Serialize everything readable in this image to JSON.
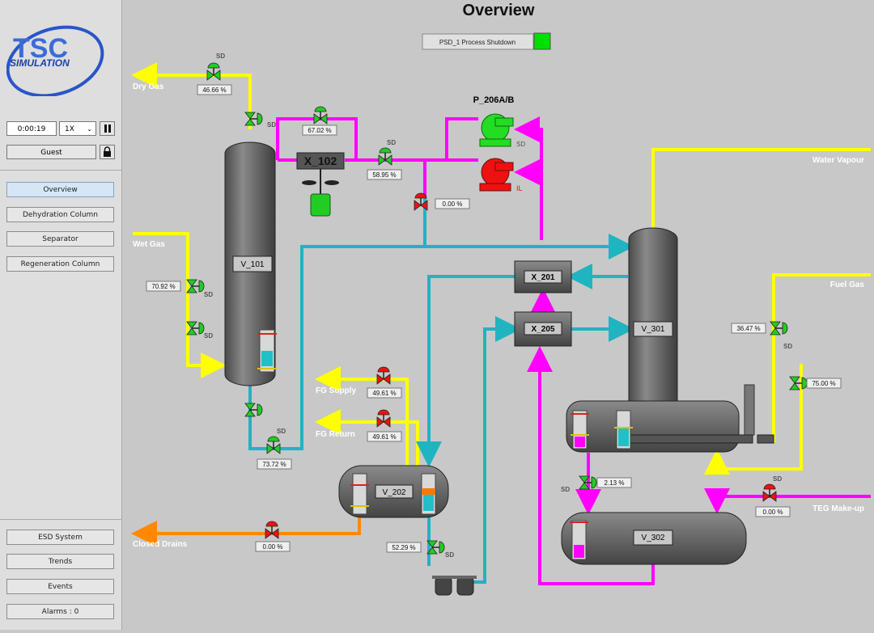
{
  "header": {
    "title": "Overview"
  },
  "psd": {
    "label": "PSD_1   Process Shutdown",
    "status_color": "#00e000"
  },
  "logo": {
    "line1": "TSC",
    "line2": "SIMULATION"
  },
  "sim": {
    "time": "0:00:19",
    "speed": "1X",
    "user": "Guest"
  },
  "nav": [
    {
      "label": "Overview"
    },
    {
      "label": "Dehydration Column"
    },
    {
      "label": "Separator"
    },
    {
      "label": "Regeneration Column"
    }
  ],
  "bottom_nav": [
    {
      "label": "ESD System"
    },
    {
      "label": "Trends"
    },
    {
      "label": "Events"
    },
    {
      "label": "Alarms : 0"
    }
  ],
  "streams": {
    "dry_gas": "Dry Gas",
    "wet_gas": "Wet Gas",
    "water_vapour": "Water Vapour",
    "fuel_gas": "Fuel Gas",
    "fg_supply": "FG Supply",
    "fg_return": "FG Return",
    "closed_drains": "Closed Drains",
    "teg_makeup": "TEG Make-up"
  },
  "equipment": {
    "v101": "V_101",
    "x102": "X_102",
    "p206": "P_206A/B",
    "x201": "X_201",
    "x205": "X_205",
    "v301": "V_301",
    "v202": "V_202",
    "v302": "V_302"
  },
  "valves": {
    "dry_gas": "46.66 %",
    "x102_a": "67.02 %",
    "x102_b": "58.95 %",
    "pump_bypass": "0.00 %",
    "wet_gas": "70.92 %",
    "v101_bottom": "73.72 %",
    "fg_supply": "49.61 %",
    "fg_return": "49.61 %",
    "closed_drains": "0.00 %",
    "v202_out": "52.29 %",
    "v301_bottom": "2.13 %",
    "teg_makeup": "0.00 %",
    "fuel_gas": "36.47 %",
    "fuel_gas_2": "75.00 %"
  },
  "tags": {
    "sd": "SD",
    "il": "IL"
  }
}
